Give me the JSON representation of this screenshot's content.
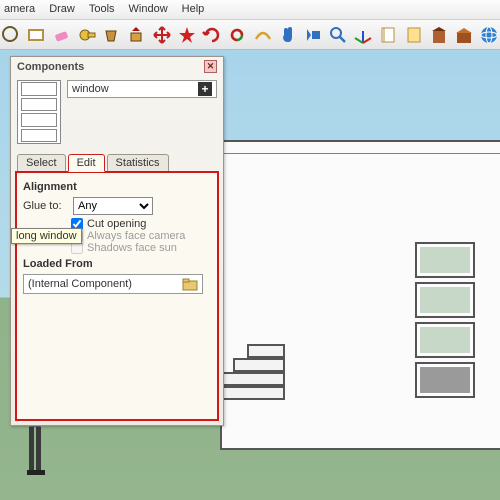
{
  "menu": {
    "items": [
      "amera",
      "Draw",
      "Tools",
      "Window",
      "Help"
    ]
  },
  "toolbar_icons": [
    "select-arrow",
    "rectangle",
    "eraser",
    "tape-measure",
    "paint-bucket",
    "push-pull",
    "move",
    "extrude-star",
    "rotate-red",
    "rotate-green",
    "offset",
    "hand-pan",
    "dolly",
    "zoom",
    "axes",
    "doc1",
    "doc2",
    "building",
    "warehouse",
    "globe"
  ],
  "panel": {
    "title": "Components",
    "component_name": "window",
    "tabs": [
      "Select",
      "Edit",
      "Statistics"
    ],
    "active_tab": "Edit",
    "alignment_label": "Alignment",
    "glue_label": "Glue to:",
    "glue_value": "Any",
    "cut_opening_label": "Cut opening",
    "cut_opening_checked": true,
    "face_camera_label": "Always face camera",
    "shadows_label": "Shadows face sun",
    "tooltip": "long window",
    "loaded_from_label": "Loaded From",
    "loaded_from_value": "(Internal Component)"
  }
}
